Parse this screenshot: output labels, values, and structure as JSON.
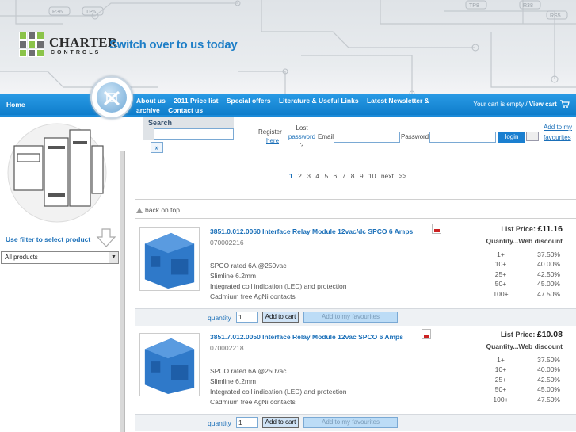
{
  "header": {
    "logo_name": "CHARTER",
    "logo_sub": "CONTROLS",
    "tagline": "Switch over to us today",
    "pcb_labels": [
      "R36",
      "TP6",
      "TP8",
      "R38",
      "RS5"
    ]
  },
  "nav": {
    "home": "Home",
    "links": [
      "About us",
      "2011 Price list",
      "Special offers",
      "Literature & Useful Links",
      "Latest Newsletter & archive",
      "Contact us"
    ],
    "cart_text": "Your cart is empty / ",
    "cart_link": "View cart"
  },
  "search": {
    "label": "Search",
    "go": "»",
    "value": ""
  },
  "account": {
    "register": "Register",
    "register_link": "here",
    "lost": "Lost",
    "lost_link": "password",
    "lost_q": "?",
    "email_label": "Email",
    "password_label": "Password",
    "login_label": "login",
    "add_fav": "Add to my favourites"
  },
  "sidebar": {
    "filter_label": "Use filter to select product",
    "select_value": "All products"
  },
  "pager": {
    "current": "1",
    "pages": [
      "2",
      "3",
      "4",
      "5",
      "6",
      "7",
      "8",
      "9",
      "10"
    ],
    "next": "next >>"
  },
  "back_label": "back on top",
  "products": [
    {
      "title": "3851.0.012.0060 Interface Relay Module 12vac/dc SPCO 6 Amps",
      "code": "070002216",
      "specs": [
        "SPCO rated 6A @250vac",
        "Slimline 6.2mm",
        "Integrated coil indication (LED) and protection",
        "Cadmium free AgNi contacts"
      ],
      "list_price_label": "List Price:",
      "list_price": "£11.16",
      "qty_header": "Quantity...Web discount",
      "tiers": [
        {
          "q": "1+",
          "d": "37.50%"
        },
        {
          "q": "10+",
          "d": "40.00%"
        },
        {
          "q": "25+",
          "d": "42.50%"
        },
        {
          "q": "50+",
          "d": "45.00%"
        },
        {
          "q": "100+",
          "d": "47.50%"
        }
      ],
      "qty_label": "quantity",
      "qty_value": "1",
      "add_cart": "Add to cart",
      "add_fav": "Add to my favourites"
    },
    {
      "title": "3851.7.012.0050 Interface Relay Module 12vac SPCO 6 Amps",
      "code": "070002218",
      "specs": [
        "SPCO rated 6A @250vac",
        "Slimline 6.2mm",
        "Integrated coil indication (LED) and protection",
        "Cadmium free AgNi contacts"
      ],
      "list_price_label": "List Price:",
      "list_price": "£10.08",
      "qty_header": "Quantity...Web discount",
      "tiers": [
        {
          "q": "1+",
          "d": "37.50%"
        },
        {
          "q": "10+",
          "d": "40.00%"
        },
        {
          "q": "25+",
          "d": "42.50%"
        },
        {
          "q": "50+",
          "d": "45.00%"
        },
        {
          "q": "100+",
          "d": "47.50%"
        }
      ],
      "qty_label": "quantity",
      "qty_value": "1",
      "add_cart": "Add to cart",
      "add_fav": "Add to my favourites"
    }
  ],
  "colors": {
    "brand_blue": "#1a7fd0",
    "link_blue": "#1a6fb8",
    "pcb_grey": "#c9ced3"
  }
}
